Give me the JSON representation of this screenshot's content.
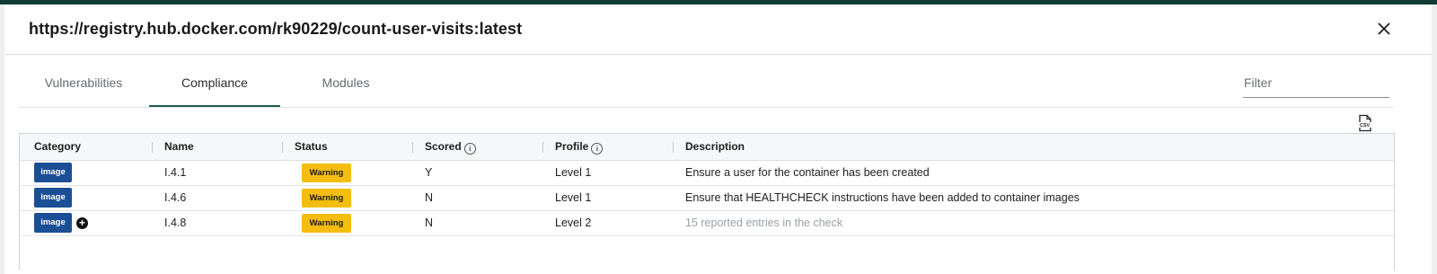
{
  "modal": {
    "title": "https://registry.hub.docker.com/rk90229/count-user-visits:latest",
    "close_icon": "close-icon"
  },
  "tabs": [
    {
      "label": "Vulnerabilities",
      "active": false
    },
    {
      "label": "Compliance",
      "active": true
    },
    {
      "label": "Modules",
      "active": false
    }
  ],
  "filter": {
    "placeholder": "Filter",
    "value": ""
  },
  "export": {
    "icon": "csv-export-icon"
  },
  "table": {
    "columns": {
      "category": "Category",
      "name": "Name",
      "status": "Status",
      "scored": "Scored",
      "profile": "Profile",
      "description": "Description"
    },
    "info_glyph": "i",
    "rows": [
      {
        "category": "image",
        "name": "I.4.1",
        "status": "Warning",
        "scored": "Y",
        "profile": "Level 1",
        "description": "Ensure a user for the container has been created",
        "expandable": false
      },
      {
        "category": "image",
        "name": "I.4.6",
        "status": "Warning",
        "scored": "N",
        "profile": "Level 1",
        "description": "Ensure that HEALTHCHECK instructions have been added to container images",
        "expandable": false
      },
      {
        "category": "image",
        "name": "I.4.8",
        "status": "Warning",
        "scored": "N",
        "profile": "Level 2",
        "description": "15 reported entries in the check",
        "expandable": true
      }
    ]
  },
  "colors": {
    "accent_tab": "#1e5e4f",
    "category_badge": "#1b4f95",
    "warning_badge": "#f5bd0f",
    "top_bar": "#0f3d33"
  }
}
